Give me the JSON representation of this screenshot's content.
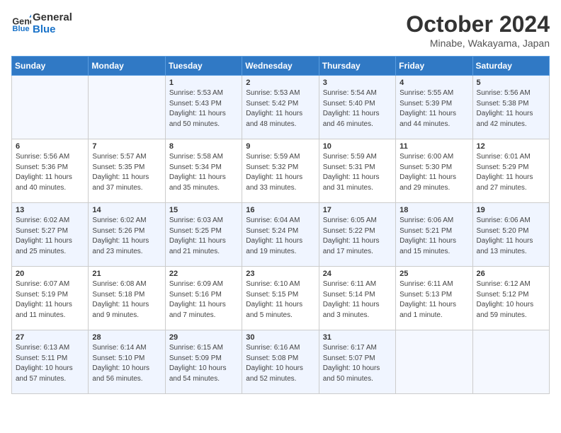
{
  "header": {
    "logo_line1": "General",
    "logo_line2": "Blue",
    "month": "October 2024",
    "location": "Minabe, Wakayama, Japan"
  },
  "columns": [
    "Sunday",
    "Monday",
    "Tuesday",
    "Wednesday",
    "Thursday",
    "Friday",
    "Saturday"
  ],
  "rows": [
    [
      {
        "day": "",
        "info": ""
      },
      {
        "day": "",
        "info": ""
      },
      {
        "day": "1",
        "info": "Sunrise: 5:53 AM\nSunset: 5:43 PM\nDaylight: 11 hours and 50 minutes."
      },
      {
        "day": "2",
        "info": "Sunrise: 5:53 AM\nSunset: 5:42 PM\nDaylight: 11 hours and 48 minutes."
      },
      {
        "day": "3",
        "info": "Sunrise: 5:54 AM\nSunset: 5:40 PM\nDaylight: 11 hours and 46 minutes."
      },
      {
        "day": "4",
        "info": "Sunrise: 5:55 AM\nSunset: 5:39 PM\nDaylight: 11 hours and 44 minutes."
      },
      {
        "day": "5",
        "info": "Sunrise: 5:56 AM\nSunset: 5:38 PM\nDaylight: 11 hours and 42 minutes."
      }
    ],
    [
      {
        "day": "6",
        "info": "Sunrise: 5:56 AM\nSunset: 5:36 PM\nDaylight: 11 hours and 40 minutes."
      },
      {
        "day": "7",
        "info": "Sunrise: 5:57 AM\nSunset: 5:35 PM\nDaylight: 11 hours and 37 minutes."
      },
      {
        "day": "8",
        "info": "Sunrise: 5:58 AM\nSunset: 5:34 PM\nDaylight: 11 hours and 35 minutes."
      },
      {
        "day": "9",
        "info": "Sunrise: 5:59 AM\nSunset: 5:32 PM\nDaylight: 11 hours and 33 minutes."
      },
      {
        "day": "10",
        "info": "Sunrise: 5:59 AM\nSunset: 5:31 PM\nDaylight: 11 hours and 31 minutes."
      },
      {
        "day": "11",
        "info": "Sunrise: 6:00 AM\nSunset: 5:30 PM\nDaylight: 11 hours and 29 minutes."
      },
      {
        "day": "12",
        "info": "Sunrise: 6:01 AM\nSunset: 5:29 PM\nDaylight: 11 hours and 27 minutes."
      }
    ],
    [
      {
        "day": "13",
        "info": "Sunrise: 6:02 AM\nSunset: 5:27 PM\nDaylight: 11 hours and 25 minutes."
      },
      {
        "day": "14",
        "info": "Sunrise: 6:02 AM\nSunset: 5:26 PM\nDaylight: 11 hours and 23 minutes."
      },
      {
        "day": "15",
        "info": "Sunrise: 6:03 AM\nSunset: 5:25 PM\nDaylight: 11 hours and 21 minutes."
      },
      {
        "day": "16",
        "info": "Sunrise: 6:04 AM\nSunset: 5:24 PM\nDaylight: 11 hours and 19 minutes."
      },
      {
        "day": "17",
        "info": "Sunrise: 6:05 AM\nSunset: 5:22 PM\nDaylight: 11 hours and 17 minutes."
      },
      {
        "day": "18",
        "info": "Sunrise: 6:06 AM\nSunset: 5:21 PM\nDaylight: 11 hours and 15 minutes."
      },
      {
        "day": "19",
        "info": "Sunrise: 6:06 AM\nSunset: 5:20 PM\nDaylight: 11 hours and 13 minutes."
      }
    ],
    [
      {
        "day": "20",
        "info": "Sunrise: 6:07 AM\nSunset: 5:19 PM\nDaylight: 11 hours and 11 minutes."
      },
      {
        "day": "21",
        "info": "Sunrise: 6:08 AM\nSunset: 5:18 PM\nDaylight: 11 hours and 9 minutes."
      },
      {
        "day": "22",
        "info": "Sunrise: 6:09 AM\nSunset: 5:16 PM\nDaylight: 11 hours and 7 minutes."
      },
      {
        "day": "23",
        "info": "Sunrise: 6:10 AM\nSunset: 5:15 PM\nDaylight: 11 hours and 5 minutes."
      },
      {
        "day": "24",
        "info": "Sunrise: 6:11 AM\nSunset: 5:14 PM\nDaylight: 11 hours and 3 minutes."
      },
      {
        "day": "25",
        "info": "Sunrise: 6:11 AM\nSunset: 5:13 PM\nDaylight: 11 hours and 1 minute."
      },
      {
        "day": "26",
        "info": "Sunrise: 6:12 AM\nSunset: 5:12 PM\nDaylight: 10 hours and 59 minutes."
      }
    ],
    [
      {
        "day": "27",
        "info": "Sunrise: 6:13 AM\nSunset: 5:11 PM\nDaylight: 10 hours and 57 minutes."
      },
      {
        "day": "28",
        "info": "Sunrise: 6:14 AM\nSunset: 5:10 PM\nDaylight: 10 hours and 56 minutes."
      },
      {
        "day": "29",
        "info": "Sunrise: 6:15 AM\nSunset: 5:09 PM\nDaylight: 10 hours and 54 minutes."
      },
      {
        "day": "30",
        "info": "Sunrise: 6:16 AM\nSunset: 5:08 PM\nDaylight: 10 hours and 52 minutes."
      },
      {
        "day": "31",
        "info": "Sunrise: 6:17 AM\nSunset: 5:07 PM\nDaylight: 10 hours and 50 minutes."
      },
      {
        "day": "",
        "info": ""
      },
      {
        "day": "",
        "info": ""
      }
    ]
  ]
}
